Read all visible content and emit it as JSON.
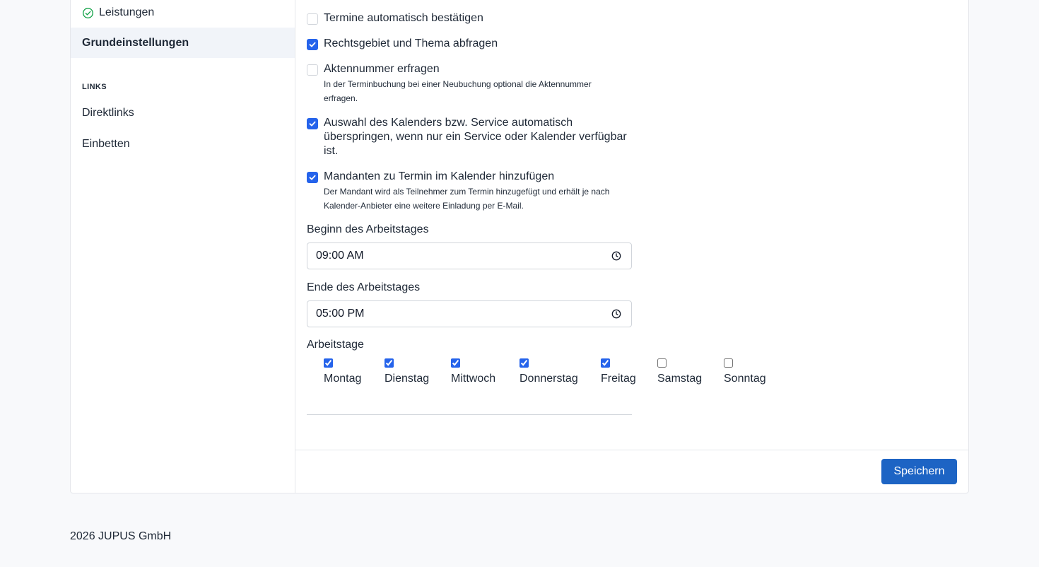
{
  "sidebar": {
    "items": [
      {
        "label": "Leistungen",
        "icon": "check-circle-icon"
      },
      {
        "label": "Grundeinstellungen",
        "active": true
      }
    ],
    "links_section": "LINKS",
    "links": [
      {
        "label": "Direktlinks"
      },
      {
        "label": "Einbetten"
      }
    ]
  },
  "settings": {
    "options": [
      {
        "label": "Termine automatisch bestätigen",
        "checked": false
      },
      {
        "label": "Rechtsgebiet und Thema abfragen",
        "checked": true
      },
      {
        "label": "Aktennummer erfragen",
        "checked": false,
        "description": "In der Terminbuchung bei einer Neubuchung optional die Aktennummer erfragen."
      },
      {
        "label": "Auswahl des Kalenders bzw. Service automatisch überspringen, wenn nur ein Service oder Kalender verfügbar ist.",
        "checked": true
      },
      {
        "label": "Mandanten zu Termin im Kalender hinzufügen",
        "checked": true,
        "description": "Der Mandant wird als Teilnehmer zum Termin hinzugefügt und erhält je nach Kalender-Anbieter eine weitere Einladung per E-Mail."
      }
    ],
    "start_label": "Beginn des Arbeitstages",
    "start_value": "09:00 AM",
    "end_label": "Ende des Arbeitstages",
    "end_value": "05:00 PM",
    "workdays_label": "Arbeitstage",
    "workdays": [
      {
        "label": "Montag",
        "checked": true
      },
      {
        "label": "Dienstag",
        "checked": true
      },
      {
        "label": "Mittwoch",
        "checked": true
      },
      {
        "label": "Donnerstag",
        "checked": true
      },
      {
        "label": "Freitag",
        "checked": true
      },
      {
        "label": "Samstag",
        "checked": false
      },
      {
        "label": "Sonntag",
        "checked": false
      }
    ],
    "save_label": "Speichern"
  },
  "footer": {
    "copyright": "2026 JUPUS GmbH"
  },
  "colors": {
    "accent": "#2563eb",
    "button": "#1d64c4",
    "success": "#16a34a"
  }
}
